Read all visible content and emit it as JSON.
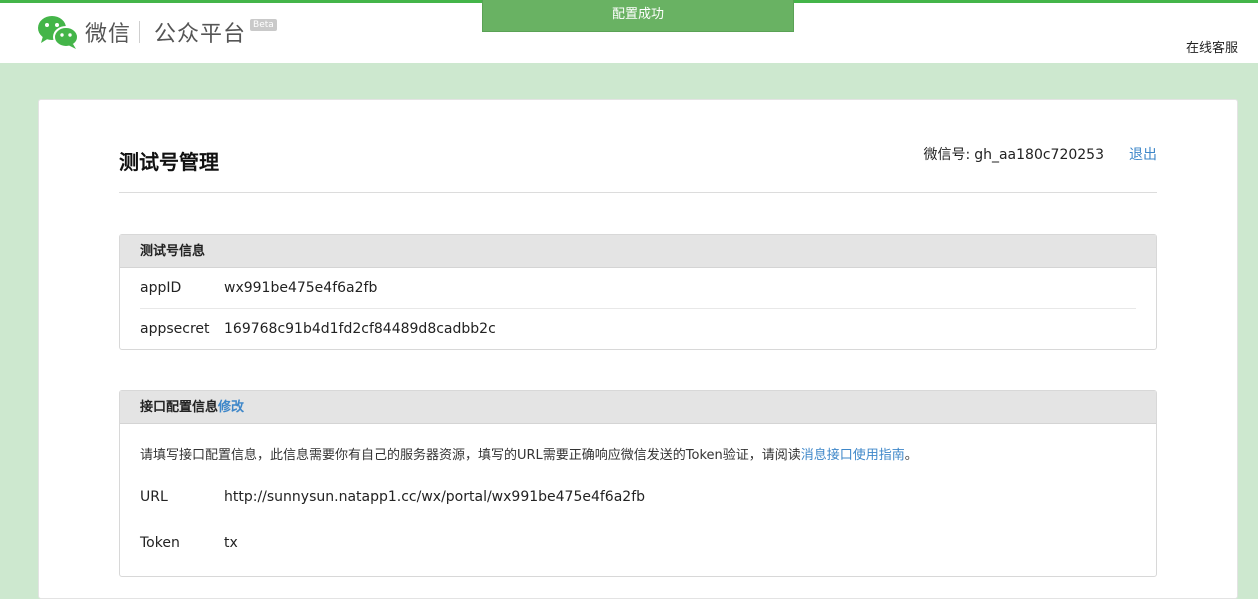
{
  "header": {
    "brand_wechat": "微信",
    "brand_platform": "公众平台",
    "beta": "Beta",
    "toast": "配置成功",
    "service": "在线客服",
    "brand_color": "#44b549"
  },
  "page": {
    "title": "测试号管理",
    "account_label": "微信号:",
    "account_value": "gh_aa180c720253",
    "logout": "退出"
  },
  "test_info": {
    "heading": "测试号信息",
    "rows": [
      {
        "key": "appID",
        "value": "wx991be475e4f6a2fb"
      },
      {
        "key": "appsecret",
        "value": "169768c91b4d1fd2cf84489d8cadbb2c"
      }
    ]
  },
  "interface": {
    "heading": "接口配置信息",
    "edit": "修改",
    "desc_prefix": "请填写接口配置信息，此信息需要你有自己的服务器资源，填写的URL需要正确响应微信发送的Token验证，请阅读",
    "desc_link": "消息接口使用指南",
    "desc_suffix": "。",
    "rows": [
      {
        "key": "URL",
        "value": "http://sunnysun.natapp1.cc/wx/portal/wx991be475e4f6a2fb"
      },
      {
        "key": "Token",
        "value": "tx"
      }
    ]
  }
}
